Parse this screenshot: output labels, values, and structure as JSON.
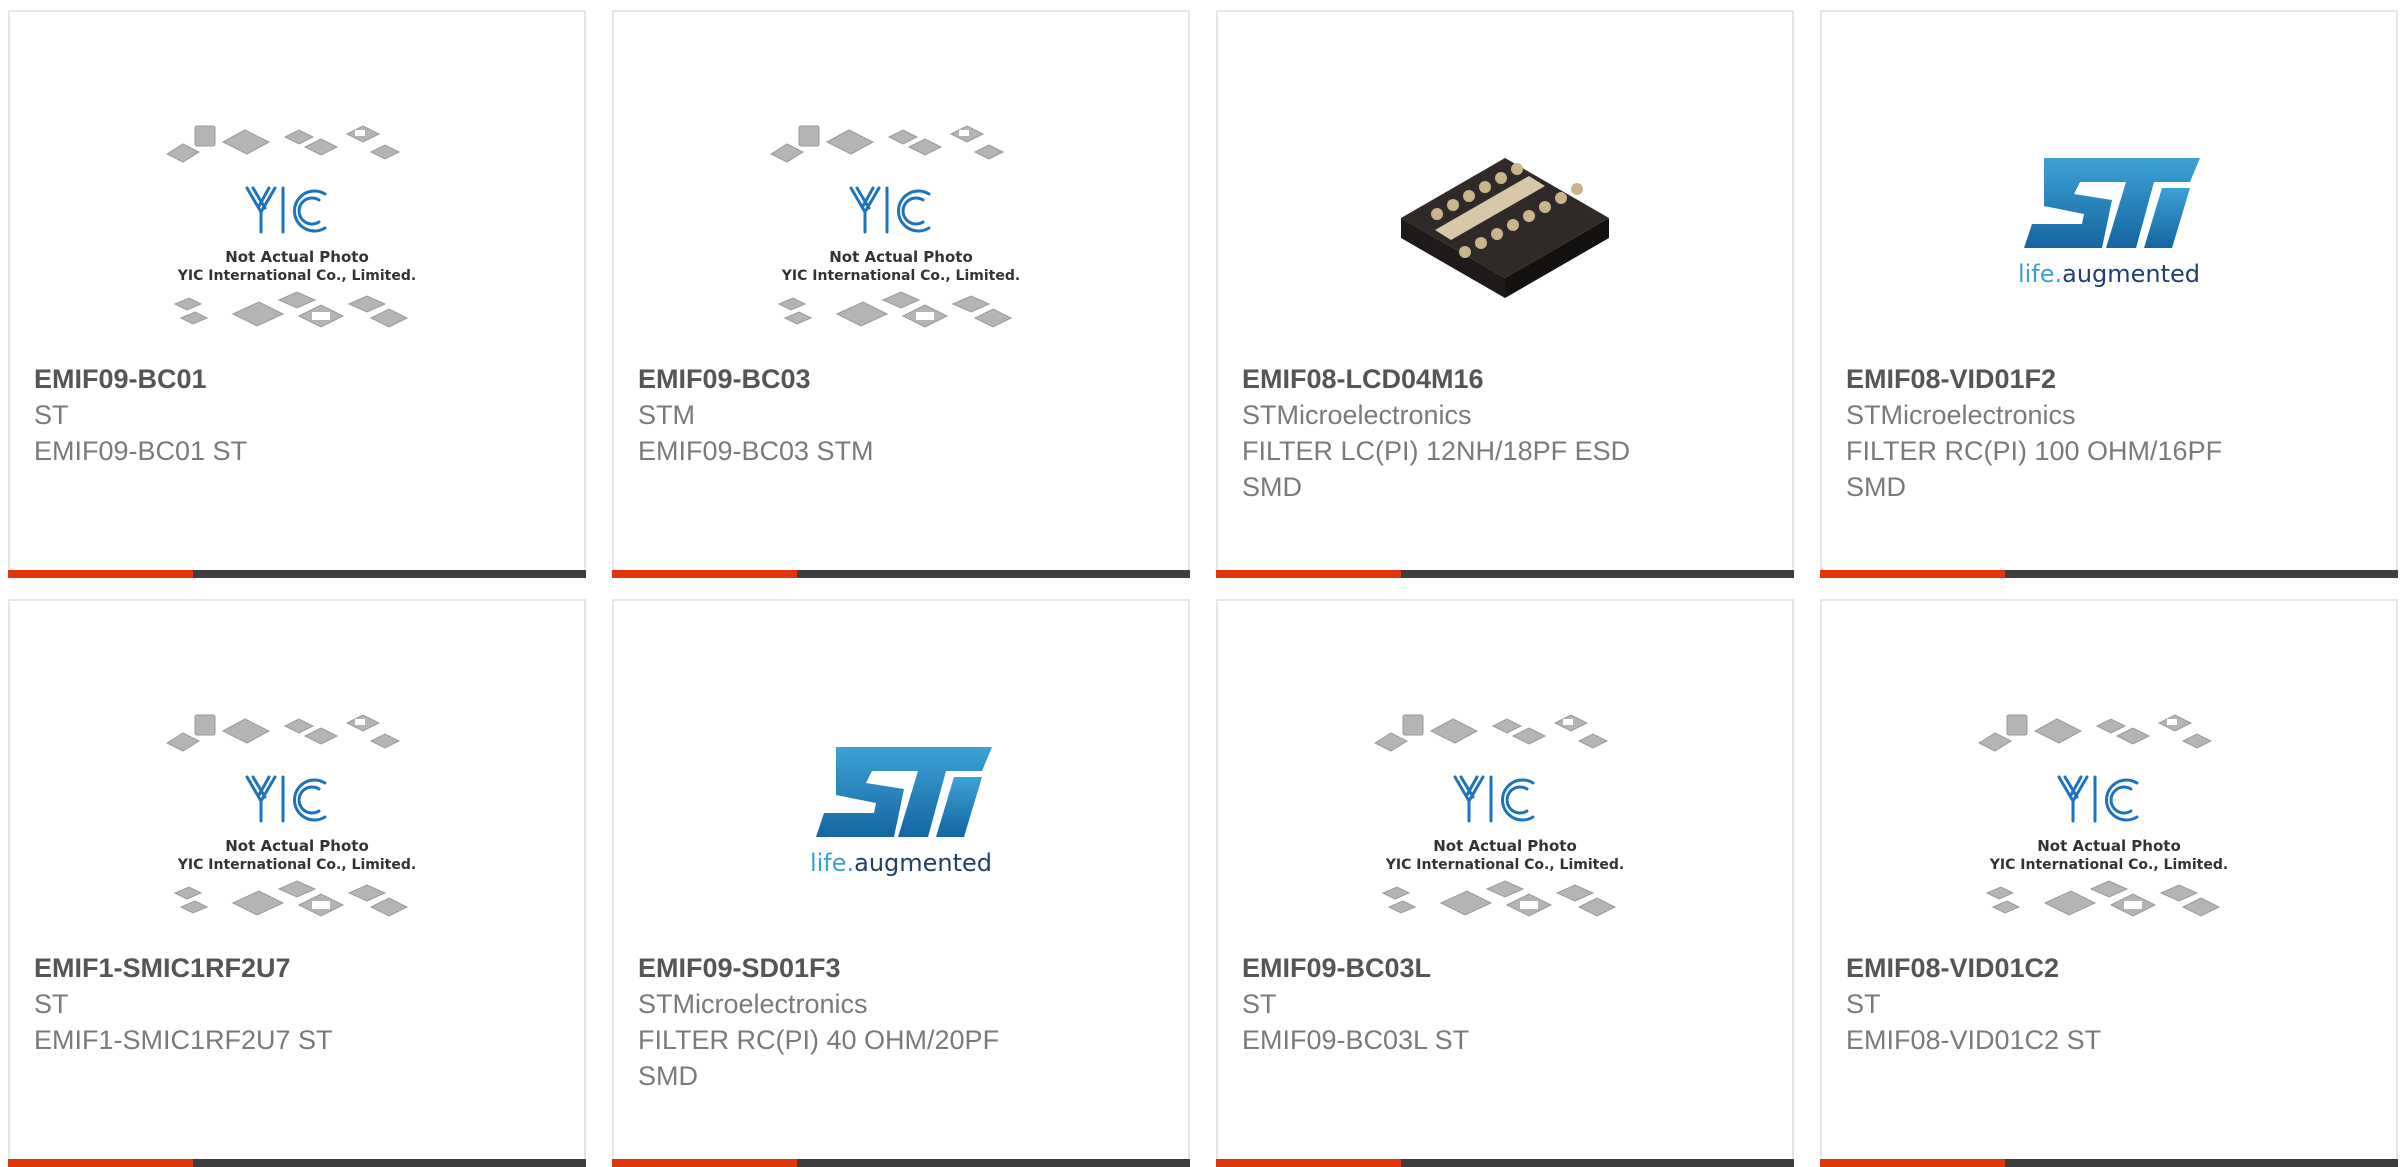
{
  "products": [
    {
      "part_number": "EMIF09-BC01",
      "manufacturer": "ST",
      "description": "EMIF09-BC01 ST",
      "image": "yic-placeholder-photo"
    },
    {
      "part_number": "EMIF09-BC03",
      "manufacturer": "STM",
      "description": "EMIF09-BC03 STM",
      "image": "yic-placeholder-photo"
    },
    {
      "part_number": "EMIF08-LCD04M16",
      "manufacturer": "STMicroelectronics",
      "description": "FILTER LC(PI) 12NH/18PF ESD\nSMD",
      "image": "chip-photo"
    },
    {
      "part_number": "EMIF08-VID01F2",
      "manufacturer": "STMicroelectronics",
      "description": "FILTER RC(PI) 100 OHM/16PF\nSMD",
      "image": "st-logo"
    },
    {
      "part_number": "EMIF1-SMIC1RF2U7",
      "manufacturer": "ST",
      "description": "EMIF1-SMIC1RF2U7 ST",
      "image": "yic-placeholder-photo"
    },
    {
      "part_number": "EMIF09-SD01F3",
      "manufacturer": "STMicroelectronics",
      "description": "FILTER RC(PI) 40 OHM/20PF\nSMD",
      "image": "st-logo"
    },
    {
      "part_number": "EMIF09-BC03L",
      "manufacturer": "ST",
      "description": "EMIF09-BC03L ST",
      "image": "yic-placeholder-photo"
    },
    {
      "part_number": "EMIF08-VID01C2",
      "manufacturer": "ST",
      "description": "EMIF08-VID01C2 ST",
      "image": "yic-placeholder-photo"
    }
  ],
  "placeholder": {
    "logo_text": "YIC",
    "line1": "Not Actual Photo",
    "line2": "YIC International Co., Limited."
  },
  "st_logo": {
    "mark": "ST",
    "tagline_life": "life.",
    "tagline_aug": "augmented"
  },
  "colors": {
    "accent": "#e0350d",
    "bar": "#3d3d3d",
    "st_blue": "#1d7cb0"
  }
}
